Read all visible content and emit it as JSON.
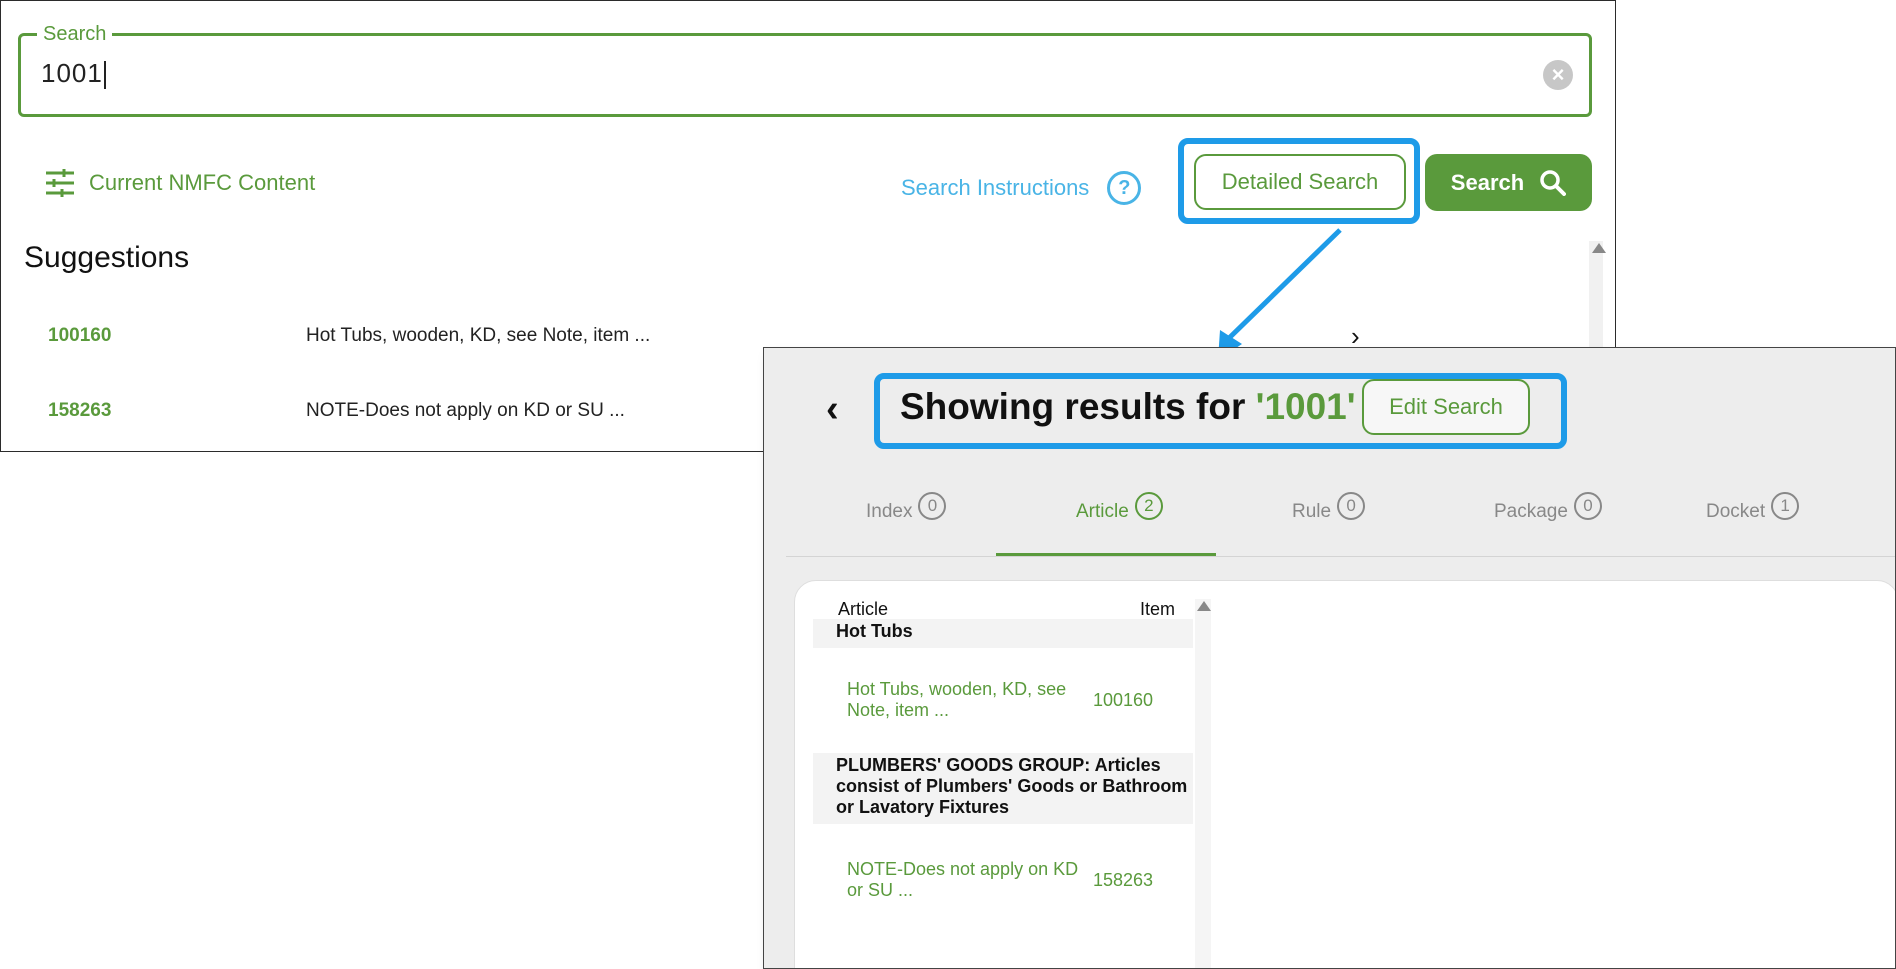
{
  "search": {
    "legend": "Search",
    "value": "1001"
  },
  "toolbar": {
    "nmfc_label": "Current NMFC Content",
    "instructions_label": "Search Instructions",
    "detailed_label": "Detailed Search",
    "search_label": "Search"
  },
  "suggestions": {
    "title": "Suggestions",
    "items": [
      {
        "code": "100160",
        "desc": "Hot Tubs, wooden, KD, see Note, item ..."
      },
      {
        "code": "158263",
        "desc": "NOTE-Does not apply on KD or SU ..."
      }
    ]
  },
  "results": {
    "prefix": "Showing results for ",
    "query": "'1001'",
    "edit_label": "Edit Search",
    "tabs": [
      {
        "label": "Index",
        "count": "0"
      },
      {
        "label": "Article",
        "count": "2"
      },
      {
        "label": "Rule",
        "count": "0"
      },
      {
        "label": "Package",
        "count": "0"
      },
      {
        "label": "Docket",
        "count": "1"
      }
    ],
    "columns": {
      "article": "Article",
      "item": "Item"
    },
    "groups": [
      {
        "header": "Hot Tubs",
        "desc": "Hot Tubs, wooden, KD, see Note, item ...",
        "item": "100160"
      },
      {
        "header": "PLUMBERS' GOODS GROUP: Articles consist of Plumbers' Goods or Bathroom or Lavatory Fixtures",
        "desc": "NOTE-Does not apply on KD or SU ...",
        "item": "158263"
      }
    ]
  },
  "colors": {
    "brand_green": "#5a9a3c",
    "highlight_blue": "#1e9be8",
    "link_blue": "#49b4e6"
  }
}
